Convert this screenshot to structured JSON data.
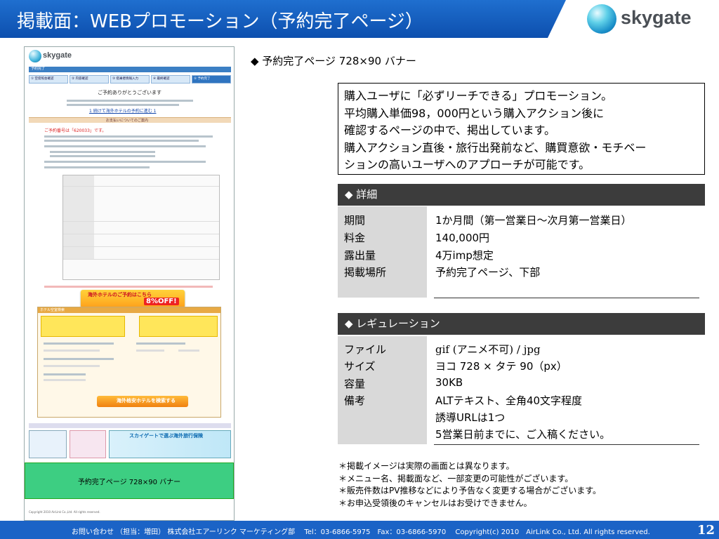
{
  "header": {
    "title": "掲載面：WEBプロモーション（予約完了ページ）",
    "logo_text": "skygate"
  },
  "mock": {
    "logo_text": "skygate",
    "bar_label": "予約完了",
    "steps": [
      "① 空席照会確認",
      "② 内容確認",
      "③ 搭乗者情報入力",
      "④ 最終確認",
      "⑤ 予約完了"
    ],
    "thanks": "ご予約ありがとうございます",
    "link_text": "1 続けて海外ホテルの予約に進む 1",
    "payment_bar": "お支払いについてのご案内",
    "reservation_number": "ご予約番号は「620033」です。",
    "hotel_banner": "海外ホテルのご予約はこちら",
    "hotel_discount": "8%OFF!",
    "search_header": "ホテル空室検索",
    "search_button": "海外格安ホテルを検索する",
    "ad_title": "スカイゲートで選ぶ海外旅行保険",
    "green_banner": "予約完了ページ 728×90 バナー",
    "footer": "Copyright 2010 AirLink Co.,Ltd. All rights reserved."
  },
  "main": {
    "section_title": "◆ 予約完了ページ 728×90 バナー",
    "intro_lines": [
      "購入ユーザに「必ずリーチできる」プロモーション。",
      "平均購入単価98，000円という購入アクション後に",
      "確認するページの中で、掲出しています。",
      "購入アクション直後・旅行出発前など、購買意欲・モチベー",
      "ションの高いユーザへのアプローチが可能です。"
    ],
    "details": {
      "title": "◆ 詳細",
      "rows": [
        {
          "label": "期間",
          "value": "1か月間（第一営業日～次月第一営業日）"
        },
        {
          "label": "料金",
          "value": "140,000円"
        },
        {
          "label": "露出量",
          "value": "4万imp想定"
        },
        {
          "label": "掲載場所",
          "value": "予約完了ページ、下部"
        }
      ]
    },
    "regulation": {
      "title": "◆ レギュレーション",
      "rows": [
        {
          "label": "ファイル",
          "value": "gif (アニメ不可) / jpg"
        },
        {
          "label": "サイズ",
          "value": "ヨコ 728 × タテ 90（px）"
        },
        {
          "label": "容量",
          "value": "30KB"
        },
        {
          "label": "備考",
          "value": "ALTテキスト、全角40文字程度"
        }
      ],
      "extra_lines": [
        "誘導URLは1つ",
        "5営業日前までに、ご入稿ください。"
      ]
    },
    "notes": [
      "＊掲載イメージは実際の画面とは異なります。",
      "＊メニュー名、掲載面など、一部変更の可能性がございます。",
      "＊販売件数はPV推移などにより予告なく変更する場合がございます。",
      "＊お申込受領後のキャンセルはお受けできません。"
    ]
  },
  "footer": {
    "text": "お問い合わせ （担当：増田） 株式会社エアーリンク マーケティング部　 Tel：03-6866-5975　Fax：03-6866-5970　 Copyright(c) 2010　AirLink Co., Ltd. All rights reserved.",
    "page": "12"
  },
  "colors": {
    "header_blue": "#1b63c6",
    "dark_bar": "#3c3c3c",
    "table_label_bg": "#d9d9d9",
    "banner_green": "#3dce82"
  }
}
